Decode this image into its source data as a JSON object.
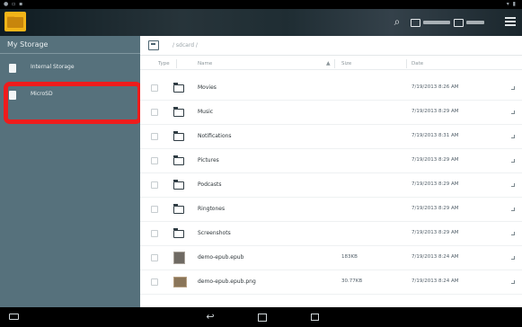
{
  "status_bar": {
    "left_icons": [
      "notification-icon",
      "usb-icon",
      "image-icon"
    ],
    "right_icons": [
      "wifi-icon",
      "battery-icon"
    ]
  },
  "action_bar": {
    "logo_icon": "file-manager-folder-icon",
    "search_icon": "search-icon",
    "storage_chips": [
      {
        "icon": "internal-storage-icon"
      },
      {
        "icon": "sd-card-icon"
      }
    ],
    "overflow_icon": "sort-list-icon"
  },
  "sidebar": {
    "title": "My Storage",
    "items": [
      {
        "label": "Internal Storage",
        "icon": "internal-storage-icon"
      },
      {
        "label": "MicroSD",
        "icon": "sd-card-icon"
      }
    ],
    "highlight_color": "#ee1c1c"
  },
  "main": {
    "path": "/ sdcard /",
    "columns": {
      "type": "Type",
      "name": "Name",
      "sort_indicator": "▲",
      "size": "Size",
      "date": "Date"
    },
    "rows": [
      {
        "kind": "folder",
        "name": "Movies",
        "size": "",
        "date": "7/19/2013 8:26 AM"
      },
      {
        "kind": "folder",
        "name": "Music",
        "size": "",
        "date": "7/19/2013 8:29 AM"
      },
      {
        "kind": "folder",
        "name": "Notifications",
        "size": "",
        "date": "7/19/2013 8:31 AM"
      },
      {
        "kind": "folder",
        "name": "Pictures",
        "size": "",
        "date": "7/19/2013 8:29 AM"
      },
      {
        "kind": "folder",
        "name": "Podcasts",
        "size": "",
        "date": "7/19/2013 8:29 AM"
      },
      {
        "kind": "folder",
        "name": "Ringtones",
        "size": "",
        "date": "7/19/2013 8:29 AM"
      },
      {
        "kind": "folder",
        "name": "Screenshots",
        "size": "",
        "date": "7/19/2013 8:29 AM"
      },
      {
        "kind": "file",
        "name": "demo-epub.epub",
        "size": "183KB",
        "date": "7/19/2013 8:24 AM"
      },
      {
        "kind": "image",
        "name": "demo-epub.epub.png",
        "size": "30.77KB",
        "date": "7/19/2013 8:24 AM"
      }
    ]
  },
  "nav_bar": {
    "icons": [
      "screenshot-icon",
      "back-icon",
      "home-icon",
      "recent-apps-icon"
    ]
  },
  "colors": {
    "sidebar_bg": "#56717c",
    "highlight": "#ee1c1c",
    "logo": "#f2b418"
  }
}
